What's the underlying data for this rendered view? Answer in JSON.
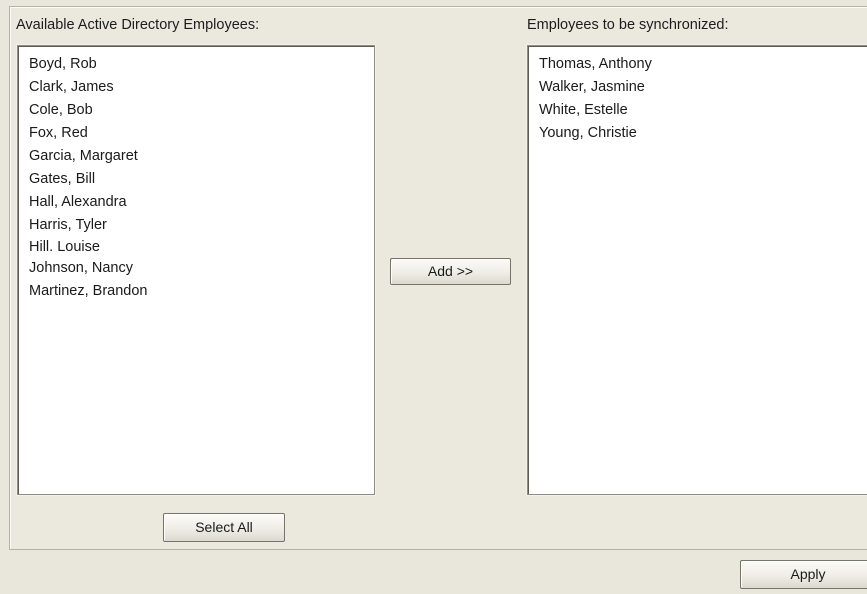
{
  "available": {
    "label": "Available Active Directory Employees:",
    "items": [
      "Boyd, Rob",
      "Clark, James",
      "Cole, Bob",
      "Fox, Red",
      "Garcia, Margaret",
      "Gates, Bill",
      "Hall, Alexandra",
      "Harris, Tyler",
      "Hill. Louise",
      "Johnson, Nancy",
      "Martinez, Brandon"
    ]
  },
  "selected": {
    "label": "Employees to be synchronized:",
    "items": [
      "Thomas, Anthony",
      "Walker, Jasmine",
      "White, Estelle",
      "Young, Christie"
    ]
  },
  "buttons": {
    "add_label": "Add >>",
    "select_all_label": "Select All",
    "apply_label": "Apply"
  }
}
